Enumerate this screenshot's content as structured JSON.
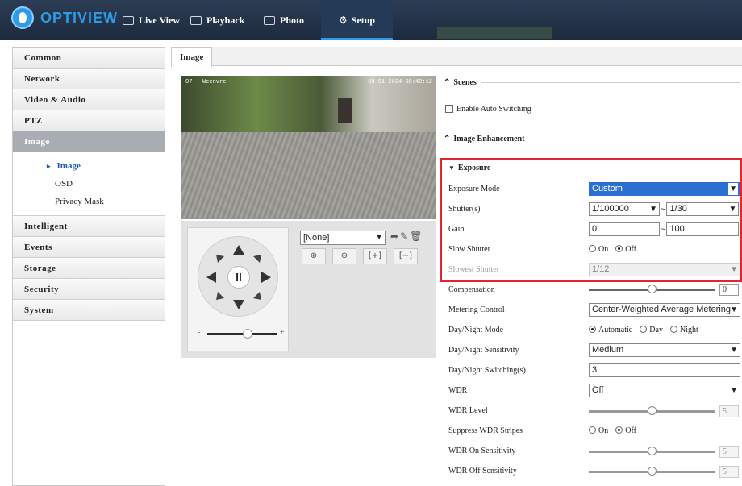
{
  "brand": {
    "logo_text": "OPTIVIEW",
    "accent": "#2d9be8"
  },
  "nav": {
    "items": [
      {
        "label": "Live View",
        "icon": "monitor-icon"
      },
      {
        "label": "Playback",
        "icon": "film-icon"
      },
      {
        "label": "Photo",
        "icon": "photo-icon"
      },
      {
        "label": "Setup",
        "icon": "gear-icon",
        "active": true
      }
    ]
  },
  "sidebar": {
    "items": [
      "Common",
      "Network",
      "Video & Audio",
      "PTZ",
      "Image"
    ],
    "image_sub": [
      "Image",
      "OSD",
      "Privacy Mask"
    ],
    "items_after": [
      "Intelligent",
      "Events",
      "Storage",
      "Security",
      "System"
    ]
  },
  "tab": {
    "label": "Image"
  },
  "video": {
    "osd_left": "07 - Weenvre",
    "osd_right": "08-01-2024 08:49:12"
  },
  "ptz": {
    "preset_value": "[None]",
    "zoom_minus": "-",
    "zoom_plus": "+"
  },
  "settings": {
    "scenes": "Scenes",
    "enable_auto_switching": "Enable Auto Switching",
    "image_enhancement": "Image Enhancement",
    "exposure": "Exposure",
    "exposure_mode_label": "Exposure Mode",
    "exposure_mode_value": "Custom",
    "shutter_label": "Shutter(s)",
    "shutter_min": "1/100000",
    "shutter_max": "1/30",
    "range_sep": "~",
    "gain_label": "Gain",
    "gain_min": "0",
    "gain_max": "100",
    "slow_shutter_label": "Slow Shutter",
    "on": "On",
    "off": "Off",
    "slowest_shutter_label": "Slowest Shutter",
    "slowest_shutter_value": "1/12",
    "compensation_label": "Compensation",
    "compensation_value": "0",
    "compensation_level": 0.5,
    "metering_label": "Metering Control",
    "metering_value": "Center-Weighted Average Metering",
    "daynight_mode_label": "Day/Night Mode",
    "automatic": "Automatic",
    "day": "Day",
    "night": "Night",
    "daynight_sens_label": "Day/Night Sensitivity",
    "daynight_sens_value": "Medium",
    "daynight_switch_label": "Day/Night Switching(s)",
    "daynight_switch_value": "3",
    "wdr_label": "WDR",
    "wdr_value": "Off",
    "wdr_level_label": "WDR Level",
    "wdr_level_value": "5",
    "suppress_wdr_label": "Suppress WDR Stripes",
    "wdr_on_sens_label": "WDR On Sensitivity",
    "wdr_on_sens_value": "5",
    "wdr_off_sens_label": "WDR Off Sensitivity",
    "wdr_off_sens_value": "5",
    "wdr_slider_level": 0.5
  },
  "colors": {
    "highlight": "#e3262e",
    "select": "#2b6fd0"
  }
}
